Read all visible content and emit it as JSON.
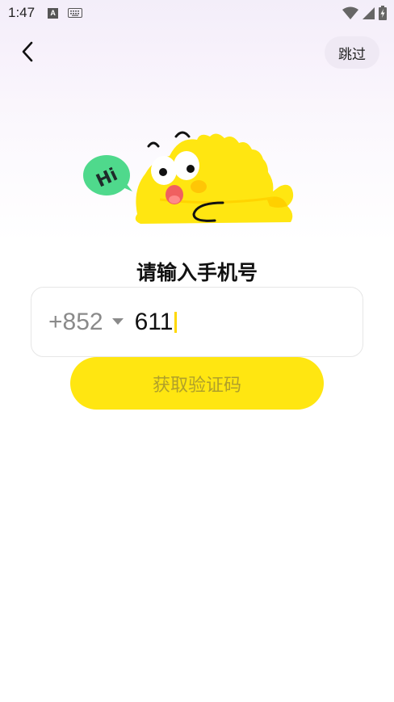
{
  "status_bar": {
    "time": "1:47",
    "notification_icon_letter": "A"
  },
  "header": {
    "back_icon": "chevron-left-icon",
    "skip_label": "跳过"
  },
  "mascot": {
    "speech_bubble_text": "Hi",
    "colors": {
      "body": "#ffe611",
      "bubble": "#4fd98c",
      "tongue": "#f06060"
    }
  },
  "main": {
    "title": "请输入手机号",
    "phone": {
      "country_code": "+852",
      "value": "611"
    },
    "get_code_label": "获取验证码"
  },
  "colors": {
    "accent": "#ffe611",
    "button_text_disabled": "#b0a02a"
  }
}
